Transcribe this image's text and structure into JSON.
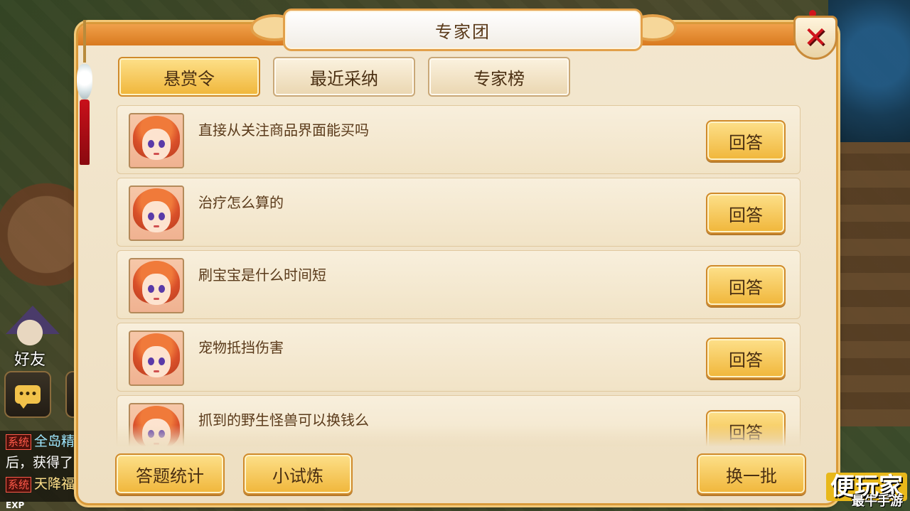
{
  "window": {
    "title": "专家团",
    "close_label": "✕"
  },
  "tabs": [
    {
      "label": "悬赏令",
      "active": true
    },
    {
      "label": "最近采纳",
      "active": false
    },
    {
      "label": "专家榜",
      "active": false
    }
  ],
  "questions": [
    {
      "text": "直接从关注商品界面能买吗",
      "button_label": "回答"
    },
    {
      "text": "治疗怎么算的",
      "button_label": "回答"
    },
    {
      "text": "刷宝宝是什么时间短",
      "button_label": "回答"
    },
    {
      "text": "宠物抵挡伤害",
      "button_label": "回答"
    },
    {
      "text": "抓到的野生怪兽可以换钱么",
      "button_label": "回答"
    }
  ],
  "footer": {
    "stats_label": "答题统计",
    "trial_label": "小试炼",
    "refresh_label": "换一批"
  },
  "hud": {
    "friend_label": "好友",
    "chat_icon_text": "•••",
    "chat_lines": [
      {
        "tag": "系统",
        "text": "全岛精"
      },
      {
        "tag": "",
        "text": "后，获得了"
      },
      {
        "tag": "系统",
        "text": "天降福"
      }
    ],
    "exp_label": "EXP"
  },
  "watermark": {
    "big": "便玩家",
    "small": "最牛手游"
  },
  "colors": {
    "accent_gold": "#f0b63a",
    "panel_bg": "#f3e7cf",
    "close_red": "#d0141c",
    "text_brown": "#5a3a1a"
  }
}
